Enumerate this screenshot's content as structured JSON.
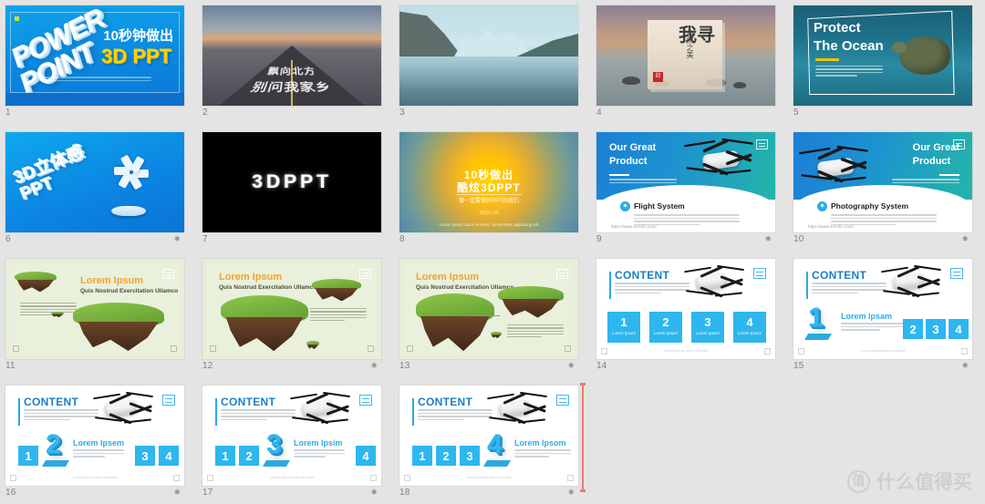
{
  "app": {
    "background_color": "#e4e4e4",
    "view": "slide-sorter",
    "accent_color": "#2eb6ee",
    "cursor_color": "#e8806a"
  },
  "watermark": {
    "logo_char": "值",
    "text": "什么值得买"
  },
  "slides": [
    {
      "number": "1",
      "starred": false,
      "kind": "title-3d-powerpoint",
      "powerpoint_word1": "POWER",
      "powerpoint_word2": "POINT",
      "headline_cn": "10秒钟做出",
      "headline_accent": "3D PPT",
      "bg": "#0b87e0"
    },
    {
      "number": "2",
      "starred": false,
      "kind": "photo-road",
      "line1_cn": "飘向北方",
      "line2_cn": "别问我家乡"
    },
    {
      "number": "3",
      "starred": false,
      "kind": "photo-lake"
    },
    {
      "number": "4",
      "starred": false,
      "kind": "photo-calligraphy",
      "big_cn": "我寻",
      "small_cn": "自然之美",
      "seal_cn": "印"
    },
    {
      "number": "5",
      "starred": false,
      "kind": "photo-ocean",
      "title_line1": "Protect",
      "title_line2": "The Ocean",
      "accent_color": "#f2c200"
    },
    {
      "number": "6",
      "starred": true,
      "kind": "title-3d-blue",
      "word_cn": "3D立体感",
      "word_en": "PPT"
    },
    {
      "number": "7",
      "starred": false,
      "kind": "title-black",
      "text": "3DPPT"
    },
    {
      "number": "8",
      "starred": false,
      "kind": "title-radial",
      "line1_cn": "10秒做出",
      "line2_cn": "酷炫3DPPT",
      "line3_cn": "做一定要做好PPT的我们",
      "line4_cn": "2019 / 01"
    },
    {
      "number": "9",
      "starred": true,
      "kind": "product",
      "title_line1": "Our Great",
      "title_line2": "Product",
      "section": "Flight System",
      "url": "https://www.smzdm.com/",
      "side": "left"
    },
    {
      "number": "10",
      "starred": true,
      "kind": "product",
      "title_line1": "Our Great",
      "title_line2": "Product",
      "section": "Photography System",
      "url": "https://www.smzdm.com/",
      "side": "right"
    },
    {
      "number": "11",
      "starred": false,
      "kind": "island",
      "heading": "Lorem Ipsum",
      "subheading": "Quis Nostrud Exercitation Ullamco",
      "variant": "a"
    },
    {
      "number": "12",
      "starred": true,
      "kind": "island",
      "heading": "Lorem Ipsum",
      "subheading": "Quis Nostrud Exercitation Ullamco",
      "variant": "b"
    },
    {
      "number": "13",
      "starred": true,
      "kind": "island",
      "heading": "Lorem Ipsum",
      "subheading": "Quis Nostrud Exercitation Ullamco",
      "variant": "c"
    },
    {
      "number": "14",
      "starred": false,
      "kind": "content",
      "title": "CONTENT",
      "highlight": null,
      "boxes": [
        "1",
        "2",
        "3",
        "4"
      ],
      "box_label": "Lorem Ipsum",
      "lead_label": null,
      "footer": "Lorem ipsum dolor sit amet"
    },
    {
      "number": "15",
      "starred": true,
      "kind": "content",
      "title": "CONTENT",
      "highlight": "1",
      "boxes": [
        "2",
        "3",
        "4"
      ],
      "box_label": "Lorem Ipsum",
      "lead_label": "Lorem Ipsam",
      "footer": "Lorem ipsum dolor sit amet"
    },
    {
      "number": "16",
      "starred": true,
      "kind": "content",
      "title": "CONTENT",
      "highlight": "2",
      "boxes_before": [
        "1"
      ],
      "boxes_after": [
        "3",
        "4"
      ],
      "box_label": "Lorem Ipsum",
      "lead_label": "Lorem Ipsem",
      "footer": "Lorem ipsum dolor sit amet"
    },
    {
      "number": "17",
      "starred": true,
      "kind": "content",
      "title": "CONTENT",
      "highlight": "3",
      "boxes_before": [
        "1",
        "2"
      ],
      "boxes_after": [
        "4"
      ],
      "box_label": "Lorem Ipsum",
      "lead_label": "Lorem Ipsim",
      "footer": "Lorem ipsum dolor sit amet"
    },
    {
      "number": "18",
      "starred": true,
      "kind": "content",
      "title": "CONTENT",
      "highlight": "4",
      "boxes_before": [
        "1",
        "2",
        "3"
      ],
      "boxes_after": [],
      "box_label": "Lorem Ipsum",
      "lead_label": "Lorem Ipsom",
      "footer": "Lorem ipsum dolor sit amet"
    }
  ],
  "star_glyph": "✸"
}
